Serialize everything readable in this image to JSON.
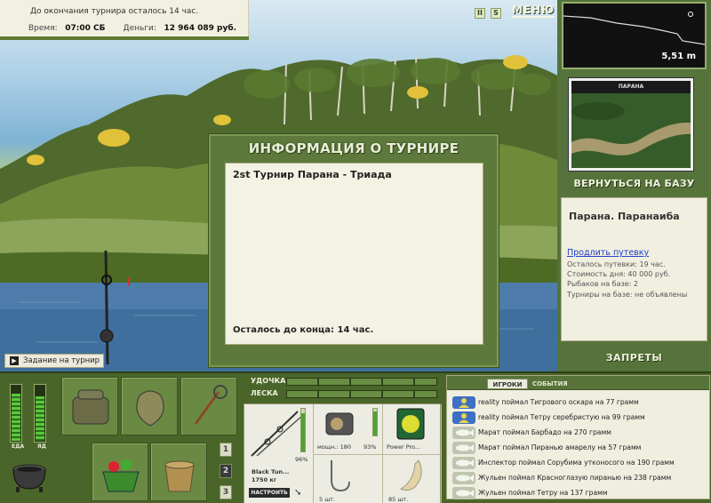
{
  "top_info": {
    "countdown": "До окончания турнира осталось 14 час.",
    "time_label": "Время:",
    "time_value": "07:00 СБ",
    "money_label": "Деньги:",
    "money_value": "12 964 089 руб."
  },
  "top_menu": {
    "pause_icon": "II",
    "sound_icon": "S",
    "menu_label": "МЕНЮ"
  },
  "depth_panel": {
    "depth": "5,51 m"
  },
  "right_panel": {
    "map_header": "ПАРАНА",
    "back_to_base": "ВЕРНУТЬСЯ НА БАЗУ",
    "base_title": "Парана. Паранаиба",
    "extend_link": "Продлить путевку",
    "lines": [
      "Осталось путевки: 19 час.",
      "Стоимость дня: 40 000 руб.",
      "Рыбаков на базе: 2",
      "Турниры на базе: не объявлены"
    ],
    "bans": "ЗАПРЕТЫ"
  },
  "modal": {
    "title": "ИНФОРМАЦИЯ О ТУРНИРЕ",
    "tournament_name": "2st Турнир Парана - Триада",
    "remaining": "Осталось до конца: 14 час."
  },
  "task_button": "Задание на турнир",
  "status": {
    "food_label": "ЕДА",
    "poison_label": "ЯД",
    "food_level": 0.85,
    "poison_level": 0.8
  },
  "inventory_pages": [
    "1",
    "2",
    "3"
  ],
  "tackle": {
    "rod_label": "УДОЧКА",
    "line_label": "ЛЕСКА",
    "rod_name": "Black Tun...",
    "rod_weight": "1750 кг",
    "rod_percent": "96%",
    "reel_power": "мощн.: 180",
    "reel_percent": "93%",
    "line_name": "Power Pro...",
    "hooks_count": "5 шт.",
    "bait_count": "85 шт.",
    "tune_button": "НАСТРОИТЬ"
  },
  "events": {
    "tab_players": "ИГРОКИ",
    "tab_events": "СОБЫТИЯ",
    "rows": [
      {
        "icon": "people-icon",
        "text": "reality поймал Тигрового оскара на 77 грамм"
      },
      {
        "icon": "people-icon",
        "text": "reality поймал Тетру серебристую на 99 грамм"
      },
      {
        "icon": "fish-icon",
        "text": "Марат поймал Барбадо на 270 грамм"
      },
      {
        "icon": "fish-icon",
        "text": "Марат поймал Пиранью амарелу на 57 грамм"
      },
      {
        "icon": "fish-icon",
        "text": "Инспектор поймал Сорубима утконосого на 190 грамм"
      },
      {
        "icon": "fish-icon",
        "text": "Жульен поймал Красноглазую пиранью на 238 грамм"
      },
      {
        "icon": "fish-icon",
        "text": "Жульен поймал Тетру на 137 грамм"
      }
    ]
  }
}
